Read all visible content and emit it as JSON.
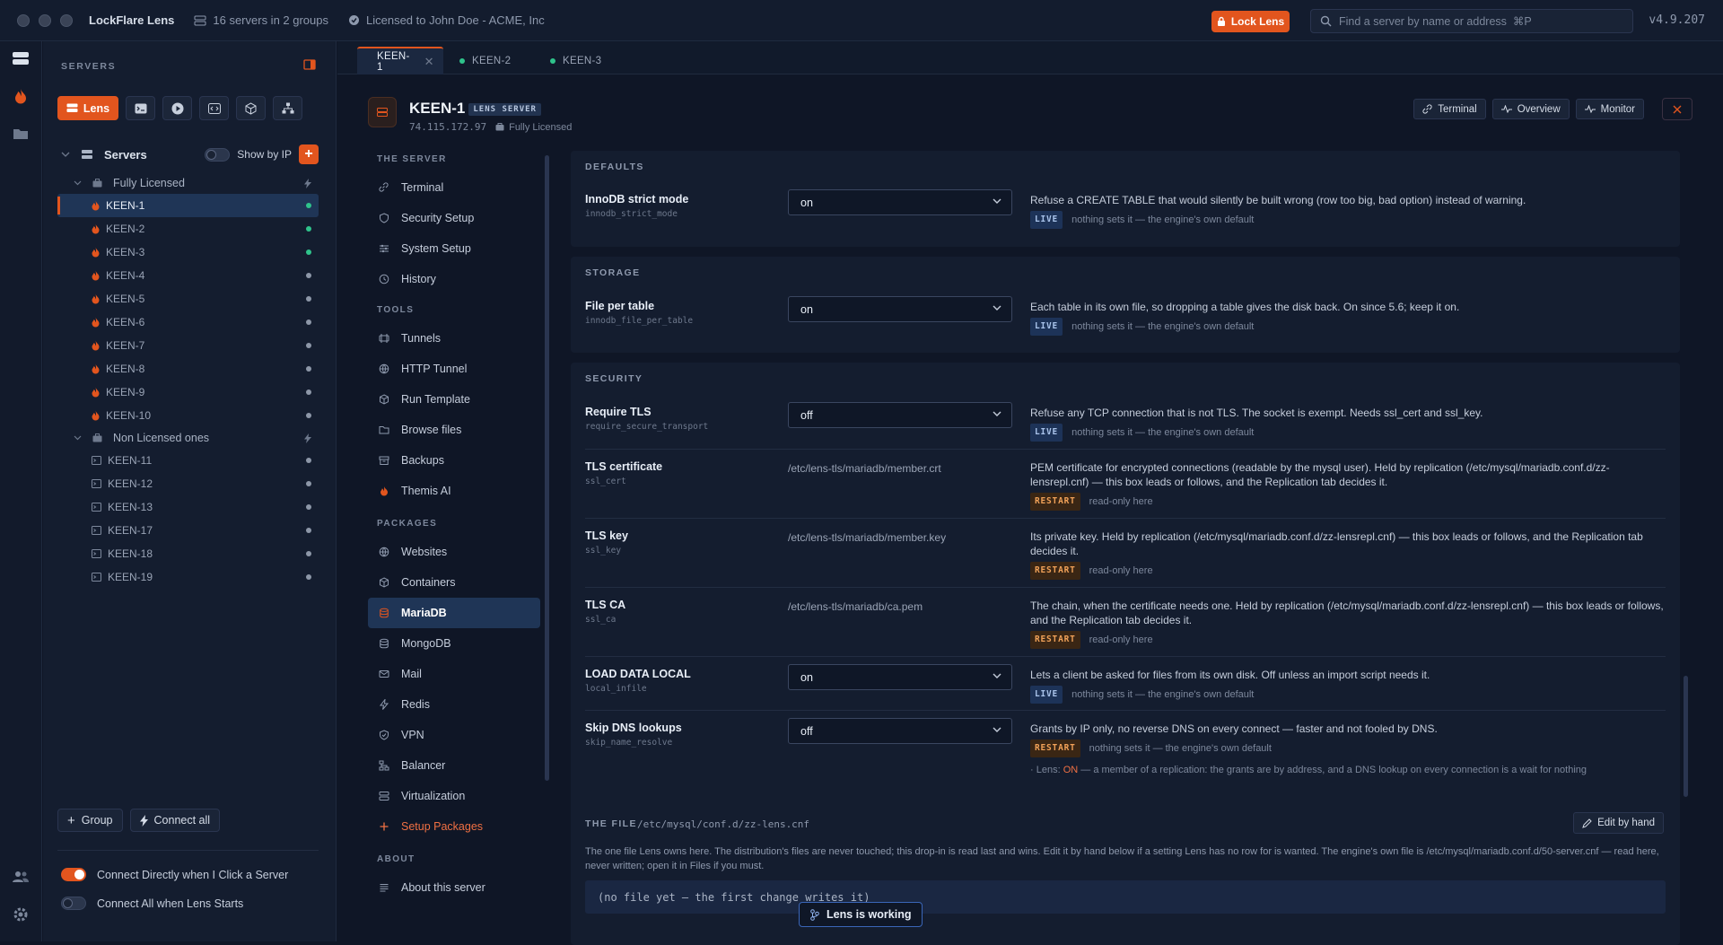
{
  "titlebar": {
    "app_name": "LockFlare Lens",
    "servers_summary": "16 servers in 2 groups",
    "license_text": "Licensed to John Doe - ACME, Inc",
    "lock_label": "Lock Lens",
    "search_placeholder": "Find a server by name or address  ⌘P",
    "version": "v4.9.207"
  },
  "sidebar": {
    "heading": "SERVERS",
    "lens_label": "Lens",
    "servers_label": "Servers",
    "show_by_ip_label": "Show by IP",
    "groups": [
      {
        "name": "Fully Licensed",
        "servers": [
          {
            "name": "KEEN-1",
            "status": "online",
            "selected": true
          },
          {
            "name": "KEEN-2",
            "status": "online"
          },
          {
            "name": "KEEN-3",
            "status": "online"
          },
          {
            "name": "KEEN-4",
            "status": "idle"
          },
          {
            "name": "KEEN-5",
            "status": "idle"
          },
          {
            "name": "KEEN-6",
            "status": "idle"
          },
          {
            "name": "KEEN-7",
            "status": "idle"
          },
          {
            "name": "KEEN-8",
            "status": "idle"
          },
          {
            "name": "KEEN-9",
            "status": "idle"
          },
          {
            "name": "KEEN-10",
            "status": "idle"
          }
        ]
      },
      {
        "name": "Non Licensed ones",
        "servers": [
          {
            "name": "KEEN-11",
            "status": "idle"
          },
          {
            "name": "KEEN-12",
            "status": "idle"
          },
          {
            "name": "KEEN-13",
            "status": "idle"
          },
          {
            "name": "KEEN-17",
            "status": "idle"
          },
          {
            "name": "KEEN-18",
            "status": "idle"
          },
          {
            "name": "KEEN-19",
            "status": "idle"
          }
        ]
      }
    ],
    "group_button": "Group",
    "connect_all_button": "Connect all",
    "options": [
      {
        "label": "Connect Directly when I Click a Server",
        "on": true
      },
      {
        "label": "Connect All when Lens Starts",
        "on": false
      }
    ]
  },
  "tabs": [
    {
      "label": "KEEN-1",
      "active": true
    },
    {
      "label": "KEEN-2",
      "active": false
    },
    {
      "label": "KEEN-3",
      "active": false
    }
  ],
  "server": {
    "name": "KEEN-1",
    "badge": "LENS SERVER",
    "ip": "74.115.172.97",
    "license": "Fully Licensed",
    "buttons": {
      "terminal": "Terminal",
      "overview": "Overview",
      "monitor": "Monitor"
    }
  },
  "subnav": {
    "sections": [
      {
        "title": "THE SERVER",
        "items": [
          "Terminal",
          "Security Setup",
          "System Setup",
          "History"
        ]
      },
      {
        "title": "TOOLS",
        "items": [
          "Tunnels",
          "HTTP Tunnel",
          "Run Template",
          "Browse files",
          "Backups",
          "Themis AI"
        ]
      },
      {
        "title": "PACKAGES",
        "items": [
          "Websites",
          "Containers",
          "MariaDB",
          "MongoDB",
          "Mail",
          "Redis",
          "VPN",
          "Balancer",
          "Virtualization",
          "Setup Packages"
        ]
      },
      {
        "title": "ABOUT",
        "items": [
          "About this server"
        ]
      }
    ],
    "active": "MariaDB"
  },
  "settings": {
    "defaults_title": "DEFAULTS",
    "storage_title": "STORAGE",
    "security_title": "SECURITY",
    "innodb": {
      "name": "InnoDB strict mode",
      "key": "innodb_strict_mode",
      "value": "on",
      "desc": "Refuse a CREATE TABLE that would silently be built wrong (row too big, bad option) instead of warning.",
      "tag": "LIVE",
      "note": "nothing sets it — the engine's own default"
    },
    "file_per_table": {
      "name": "File per table",
      "key": "innodb_file_per_table",
      "value": "on",
      "desc": "Each table in its own file, so dropping a table gives the disk back. On since 5.6; keep it on.",
      "tag": "LIVE",
      "note": "nothing sets it — the engine's own default"
    },
    "require_tls": {
      "name": "Require TLS",
      "key": "require_secure_transport",
      "value": "off",
      "desc": "Refuse any TCP connection that is not TLS. The socket is exempt. Needs ssl_cert and ssl_key.",
      "tag": "LIVE",
      "note": "nothing sets it — the engine's own default"
    },
    "tls_cert": {
      "name": "TLS certificate",
      "key": "ssl_cert",
      "value": "/etc/lens-tls/mariadb/member.crt",
      "desc": "PEM certificate for encrypted connections (readable by the mysql user). Held by replication (/etc/mysql/mariadb.conf.d/zz-lensrepl.cnf) — this box leads or follows, and the Replication tab decides it.",
      "tag": "RESTART",
      "note": "read-only here"
    },
    "tls_key": {
      "name": "TLS key",
      "key": "ssl_key",
      "value": "/etc/lens-tls/mariadb/member.key",
      "desc": "Its private key. Held by replication (/etc/mysql/mariadb.conf.d/zz-lensrepl.cnf) — this box leads or follows, and the Replication tab decides it.",
      "tag": "RESTART",
      "note": "read-only here"
    },
    "tls_ca": {
      "name": "TLS CA",
      "key": "ssl_ca",
      "value": "/etc/lens-tls/mariadb/ca.pem",
      "desc": "The chain, when the certificate needs one. Held by replication (/etc/mysql/mariadb.conf.d/zz-lensrepl.cnf) — this box leads or follows, and the Replication tab decides it.",
      "tag": "RESTART",
      "note": "read-only here"
    },
    "local_infile": {
      "name": "LOAD DATA LOCAL",
      "key": "local_infile",
      "value": "on",
      "desc": "Lets a client be asked for files from its own disk. Off unless an import script needs it.",
      "tag": "LIVE",
      "note": "nothing sets it — the engine's own default"
    },
    "skip_dns": {
      "name": "Skip DNS lookups",
      "key": "skip_name_resolve",
      "value": "off",
      "desc": "Grants by IP only, no reverse DNS on every connect — faster and not fooled by DNS.",
      "tag": "RESTART",
      "note": "nothing sets it — the engine's own default",
      "lens_prefix": "· Lens:",
      "lens_on": "ON",
      "lens_rest": "— a member of a replication: the grants are by address, and a DNS lookup on every connection is a wait for nothing"
    }
  },
  "file": {
    "title": "THE FILE",
    "path": "/etc/mysql/conf.d/zz-lens.cnf",
    "edit_button": "Edit by hand",
    "desc": "The one file Lens owns here. The distribution's files are never touched; this drop-in is read last and wins. Edit it by hand below if a setting Lens has no row for is wanted. The engine's own file is /etc/mysql/mariadb.conf.d/50-server.cnf — read here, never written; open it in Files if you must.",
    "content": "(no file yet — the first change writes it)"
  },
  "status": {
    "working": "Lens is working"
  },
  "colors": {
    "accent": "#e2551e",
    "online": "#2fc38b",
    "selected": "#1f3556",
    "background": "#0f1626"
  }
}
